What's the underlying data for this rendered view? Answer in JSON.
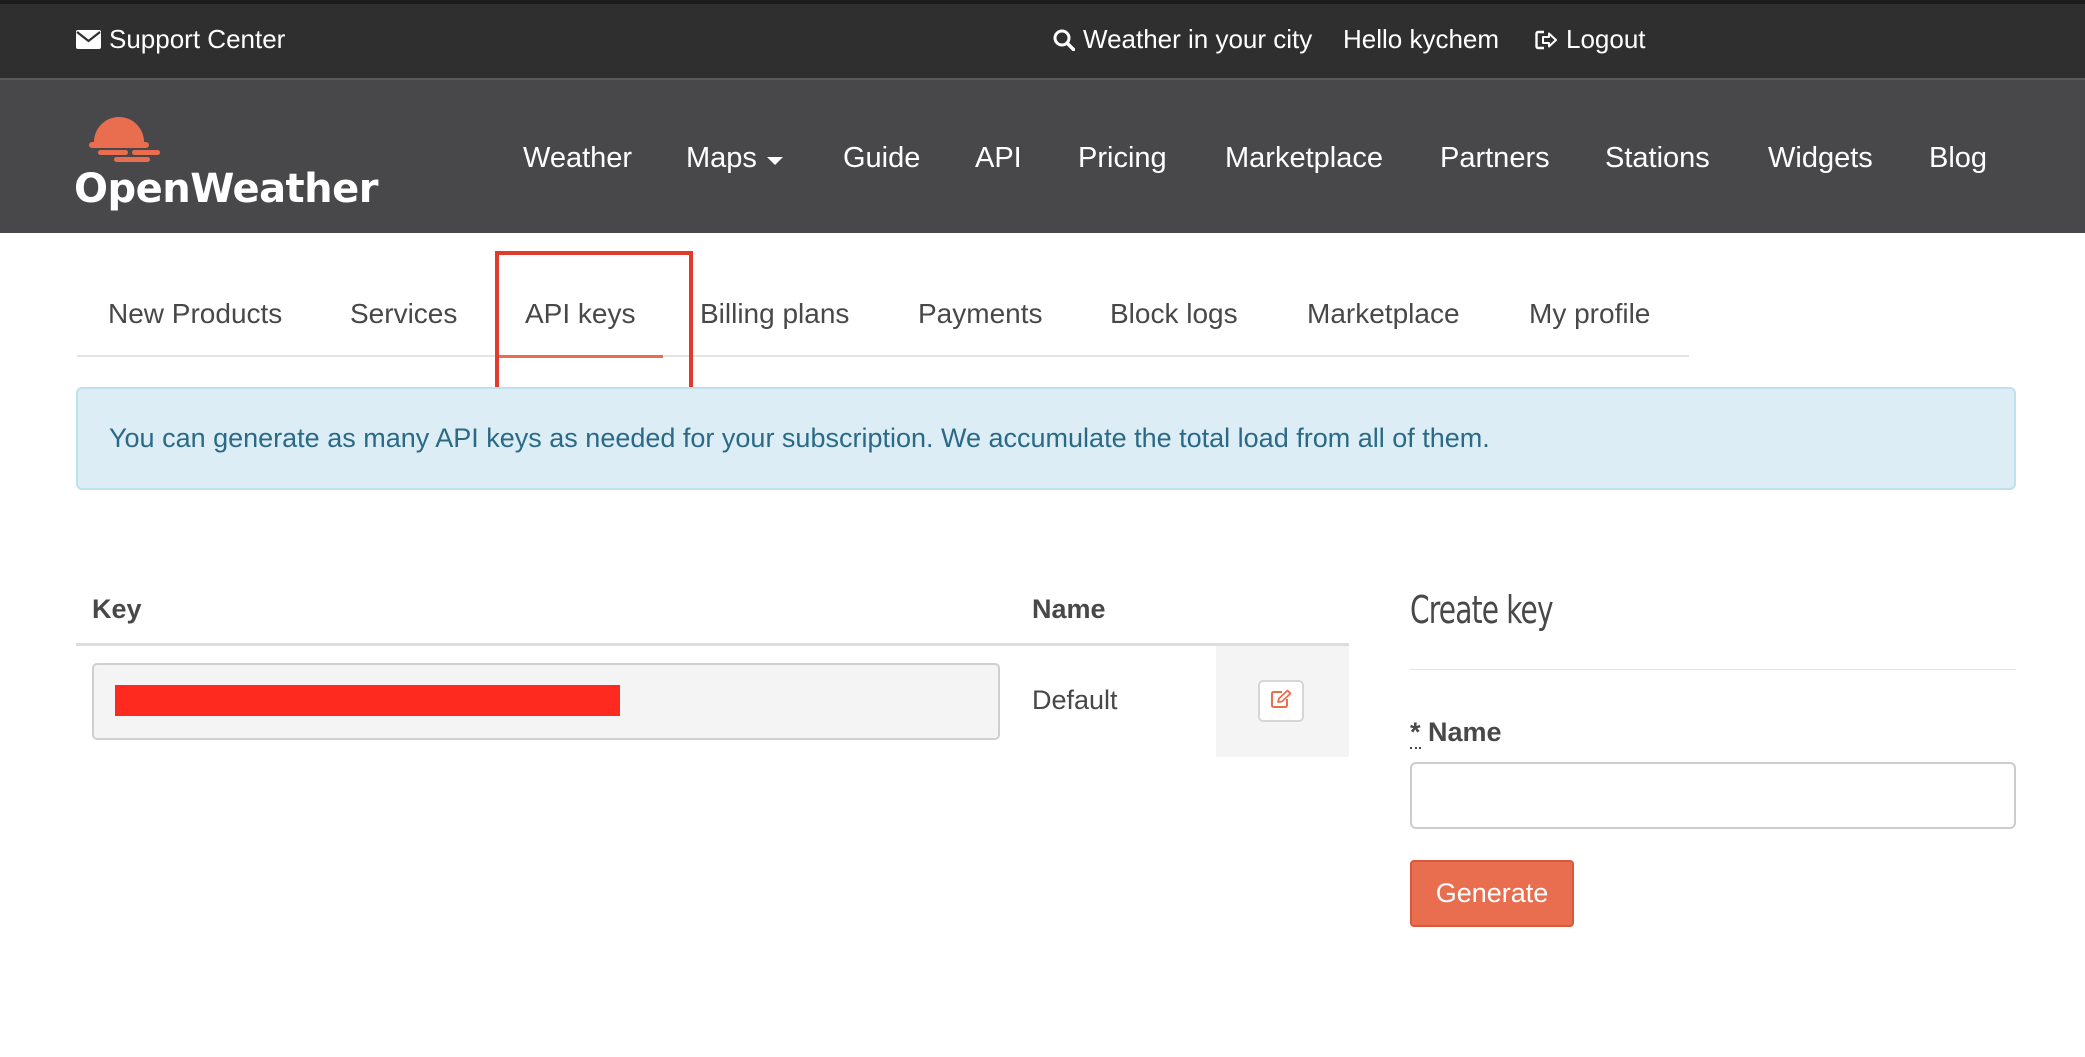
{
  "topbar": {
    "support": "Support Center",
    "search": "Weather in your city",
    "greeting": "Hello kychem",
    "logout": "Logout"
  },
  "brand": {
    "name": "OpenWeather",
    "accent": "#e96e50"
  },
  "mainnav": {
    "items": [
      "Weather",
      "Maps",
      "Guide",
      "API",
      "Pricing",
      "Marketplace",
      "Partners",
      "Stations",
      "Widgets",
      "Blog"
    ]
  },
  "tabs": {
    "items": [
      "New Products",
      "Services",
      "API keys",
      "Billing plans",
      "Payments",
      "Block logs",
      "Marketplace",
      "My profile"
    ],
    "active": "API keys"
  },
  "alert": {
    "text": "You can generate as many API keys as needed for your subscription. We accumulate the total load from all of them."
  },
  "keys_table": {
    "headers": [
      "Key",
      "Name"
    ],
    "rows": [
      {
        "key": "",
        "name": "Default"
      }
    ]
  },
  "create_key": {
    "title": "Create key",
    "required_mark": "*",
    "name_label": "Name",
    "name_value": "",
    "generate_label": "Generate"
  }
}
